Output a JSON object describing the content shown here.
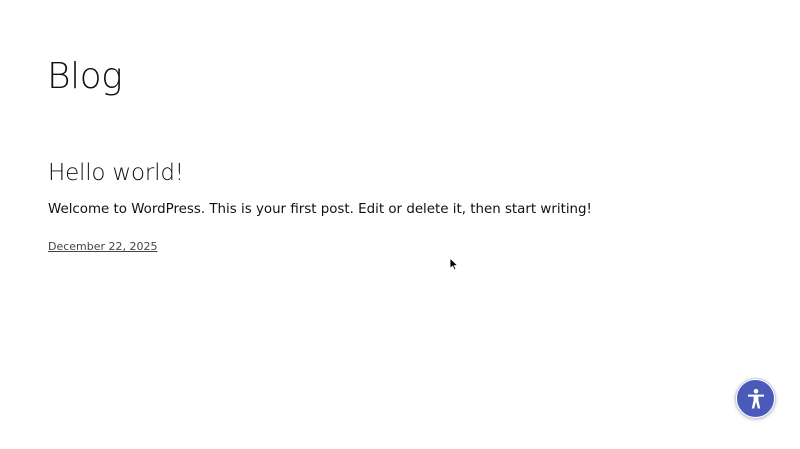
{
  "page": {
    "blog_title": "Blog"
  },
  "posts": [
    {
      "title": "Hello world!",
      "excerpt": "Welcome to WordPress. This is your first post. Edit or delete it, then start writing!",
      "date": "December 22, 2025"
    }
  ],
  "widgets": {
    "accessibility_icon": "accessibility-person-icon",
    "accessibility_color": "#4a5ab8"
  }
}
